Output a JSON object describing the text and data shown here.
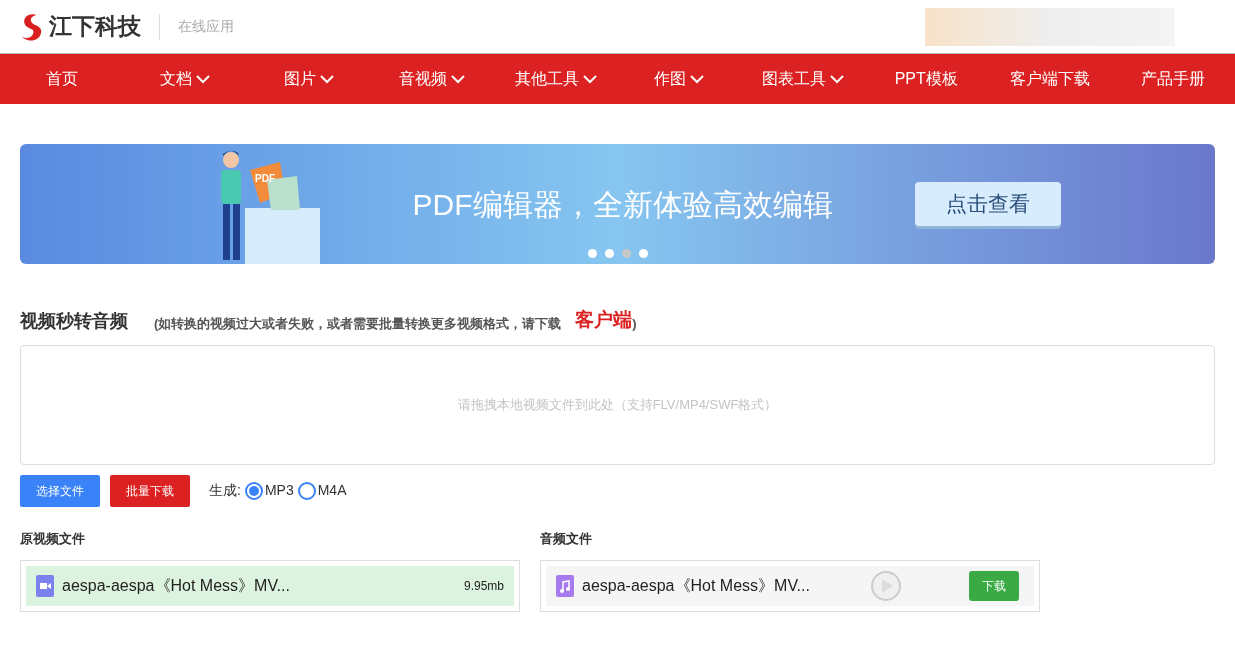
{
  "header": {
    "brand": "江下科技",
    "subtitle": "在线应用"
  },
  "nav": [
    {
      "label": "首页",
      "dropdown": false
    },
    {
      "label": "文档",
      "dropdown": true
    },
    {
      "label": "图片",
      "dropdown": true
    },
    {
      "label": "音视频",
      "dropdown": true
    },
    {
      "label": "其他工具",
      "dropdown": true
    },
    {
      "label": "作图",
      "dropdown": true
    },
    {
      "label": "图表工具",
      "dropdown": true
    },
    {
      "label": "PPT模板",
      "dropdown": false
    },
    {
      "label": "客户端下载",
      "dropdown": false
    },
    {
      "label": "产品手册",
      "dropdown": false
    }
  ],
  "banner": {
    "badge": "PDF",
    "headline": "PDF编辑器，全新体验高效编辑",
    "button": "点击查看",
    "dots": [
      {
        "selected": false
      },
      {
        "selected": false
      },
      {
        "selected": true
      },
      {
        "selected": false
      }
    ]
  },
  "tool": {
    "title": "视频秒转音频",
    "note_open": "(如转换的视频过大或者失败，或者需要批量转换更多视频格式，请下载",
    "note_link": "客户端",
    "note_close": ")",
    "dropzone": "请拖拽本地视频文件到此处（支持FLV/MP4/SWF格式）",
    "choose_button": "选择文件",
    "batch_button": "批量下载",
    "format_label": "生成:",
    "formats": [
      {
        "label": "MP3",
        "selected": true
      },
      {
        "label": "M4A",
        "selected": false
      }
    ]
  },
  "source": {
    "heading": "原视频文件",
    "file": "aespa-aespa《Hot Mess》MV...",
    "size": "9.95mb"
  },
  "output": {
    "heading": "音频文件",
    "file": "aespa-aespa《Hot Mess》MV...",
    "download": "下载"
  }
}
